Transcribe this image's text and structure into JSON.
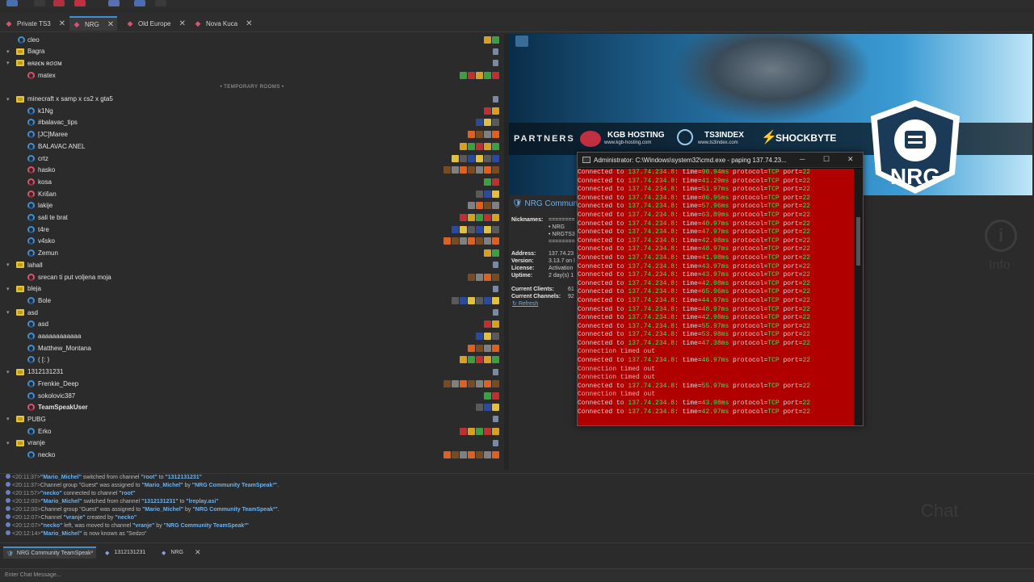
{
  "tabs": [
    {
      "label": "Private TS3",
      "close": "✕"
    },
    {
      "label": "NRG",
      "close": "✕"
    },
    {
      "label": "Old Europe",
      "close": "✕"
    },
    {
      "label": "Nova Kuca",
      "close": "✕"
    }
  ],
  "tree": {
    "rows": [
      {
        "kind": "user",
        "name": "cleo",
        "indent": 0
      },
      {
        "kind": "channel",
        "name": "Bagra"
      },
      {
        "kind": "channel",
        "name": "ѳяƨϵɴ ʀσσм"
      },
      {
        "kind": "user",
        "name": "matex",
        "red": true
      },
      {
        "kind": "spacer",
        "name": "• TEMPORARY ROOMS •"
      },
      {
        "kind": "channel",
        "name": "minecraft x samp x cs2 x gta5"
      },
      {
        "kind": "user",
        "name": "k1Ng"
      },
      {
        "kind": "user",
        "name": "#balavac_tips"
      },
      {
        "kind": "user",
        "name": "[JC]Maree"
      },
      {
        "kind": "user",
        "name": "BALAVAC ANEL"
      },
      {
        "kind": "user",
        "name": "crtz"
      },
      {
        "kind": "user",
        "name": "hasko",
        "red": true
      },
      {
        "kind": "user",
        "name": "kosa",
        "red": true
      },
      {
        "kind": "user",
        "name": "Krišan",
        "red": true
      },
      {
        "kind": "user",
        "name": "lakije"
      },
      {
        "kind": "user",
        "name": "sali te brat"
      },
      {
        "kind": "user",
        "name": "t4re"
      },
      {
        "kind": "user",
        "name": "v4sko"
      },
      {
        "kind": "user",
        "name": "Zemun"
      },
      {
        "kind": "channel",
        "name": "lahall"
      },
      {
        "kind": "user",
        "name": "srecan ti put voljena moja",
        "red": true
      },
      {
        "kind": "channel",
        "name": "bleja"
      },
      {
        "kind": "user",
        "name": "Bole"
      },
      {
        "kind": "channel",
        "name": "asd"
      },
      {
        "kind": "user",
        "name": "asd"
      },
      {
        "kind": "user",
        "name": "aaaaaaaaaaaa"
      },
      {
        "kind": "user",
        "name": "Matthew_Montana"
      },
      {
        "kind": "user",
        "name": "( [: )"
      },
      {
        "kind": "channel",
        "name": "1312131231"
      },
      {
        "kind": "user",
        "name": "Frenkie_Deep"
      },
      {
        "kind": "user",
        "name": "sokolovic387"
      },
      {
        "kind": "user",
        "name": "TeamSpeakUser",
        "bold": true,
        "red": true
      },
      {
        "kind": "channel",
        "name": "PUBG"
      },
      {
        "kind": "user",
        "name": "Erko"
      },
      {
        "kind": "channel",
        "name": "vranje"
      },
      {
        "kind": "user",
        "name": "necko"
      }
    ]
  },
  "banner": {
    "partners": "PARTNERS",
    "p1": "KGB HOSTING",
    "p1s": "www.kgb-hosting.com",
    "p2": "TS3INDEX",
    "p2s": "www.ts3index.com",
    "p3": "SHOCKBYTE",
    "logo": "NRG"
  },
  "server": {
    "title": "NRG Commun",
    "nicknames_label": "Nicknames:",
    "nick1": "========",
    "nick2": "• NRG",
    "nick3": "• NRGTS3",
    "nick4": "========",
    "address_label": "Address:",
    "address": "137.74.23",
    "version_label": "Version:",
    "version": "3.13.7 on l",
    "license_label": "License:",
    "license": "Activation",
    "uptime_label": "Uptime:",
    "uptime": "2 day(s) 1",
    "clients_label": "Current Clients:",
    "clients": "61",
    "channels_label": "Current Channels:",
    "channels": "92",
    "refresh": "Refresh",
    "info": "Info"
  },
  "cmd": {
    "title": "Administrator: C:\\Windows\\system32\\cmd.exe - paping  137.74.23...",
    "lines": [
      {
        "t": "ok",
        "ms": "90.94ms"
      },
      {
        "t": "ok",
        "ms": "41.29ms"
      },
      {
        "t": "ok",
        "ms": "51.97ms"
      },
      {
        "t": "ok",
        "ms": "86.95ms"
      },
      {
        "t": "ok",
        "ms": "57.96ms"
      },
      {
        "t": "ok",
        "ms": "63.89ms"
      },
      {
        "t": "ok",
        "ms": "40.97ms"
      },
      {
        "t": "ok",
        "ms": "47.97ms"
      },
      {
        "t": "ok",
        "ms": "42.98ms"
      },
      {
        "t": "ok",
        "ms": "48.97ms"
      },
      {
        "t": "ok",
        "ms": "41.98ms"
      },
      {
        "t": "ok",
        "ms": "43.97ms"
      },
      {
        "t": "ok",
        "ms": "43.97ms"
      },
      {
        "t": "ok",
        "ms": "42.98ms"
      },
      {
        "t": "ok",
        "ms": "65.96ms"
      },
      {
        "t": "ok",
        "ms": "44.97ms"
      },
      {
        "t": "ok",
        "ms": "48.97ms"
      },
      {
        "t": "ok",
        "ms": "42.98ms"
      },
      {
        "t": "ok",
        "ms": "55.97ms"
      },
      {
        "t": "ok",
        "ms": "53.98ms"
      },
      {
        "t": "ok",
        "ms": "47.38ms"
      },
      {
        "t": "timeout",
        "ms": ""
      },
      {
        "t": "ok",
        "ms": "46.97ms"
      },
      {
        "t": "timeout",
        "ms": ""
      },
      {
        "t": "timeout",
        "ms": ""
      },
      {
        "t": "ok",
        "ms": "55.97ms"
      },
      {
        "t": "timeout",
        "ms": ""
      },
      {
        "t": "ok",
        "ms": "43.98ms"
      },
      {
        "t": "ok",
        "ms": "42.97ms"
      }
    ],
    "connected": "Connected to",
    "ip": "137.74.234.8",
    "timeout_text": "Connection timed out",
    "proto": "TCP",
    "port": "22"
  },
  "log": [
    {
      "ts": "<20:11:37>",
      "a": "\"Mario_Michel\"",
      "mid": " switched from channel ",
      "b": "\"root\"",
      "mid2": " to ",
      "c": "\"1312131231\"",
      "end": ""
    },
    {
      "ts": "<20:11:37>",
      "a": "",
      "mid": "Channel group \"Guest\" was assigned to ",
      "b": "\"Mario_Michel\"",
      "mid2": " by ",
      "c": "\"NRG Community TeamSpeak³\"",
      "end": "."
    },
    {
      "ts": "<20:11:57>",
      "a": "\"necko\"",
      "mid": " connected to channel ",
      "b": "\"root\"",
      "mid2": "",
      "c": "",
      "end": ""
    },
    {
      "ts": "<20:12:00>",
      "a": "\"Mario_Michel\"",
      "mid": " switched from channel ",
      "b": "\"1312131231\"",
      "mid2": " to ",
      "c": "\"lreplay.asi\"",
      "end": ""
    },
    {
      "ts": "<20:12:00>",
      "a": "",
      "mid": "Channel group \"Guest\" was assigned to ",
      "b": "\"Mario_Michel\"",
      "mid2": " by ",
      "c": "\"NRG Community TeamSpeak³\"",
      "end": "."
    },
    {
      "ts": "<20:12:07>",
      "a": "",
      "mid": "Channel ",
      "b": "\"vranje\"",
      "mid2": " created by ",
      "c": "\"necko\"",
      "end": ""
    },
    {
      "ts": "<20:12:07>",
      "a": "\"necko\"",
      "mid": " left, was moved to channel ",
      "b": "\"vranje\"",
      "mid2": " by ",
      "c": "\"NRG Community TeamSpeak³\"",
      "end": ""
    },
    {
      "ts": "<20:12:14>",
      "a": "\"Mario_Michel\"",
      "mid": " is now known as \"Sedzo\"",
      "b": "",
      "mid2": "",
      "c": "",
      "end": ""
    }
  ],
  "chat": {
    "bg": "Chat",
    "tabs": [
      "NRG Community TeamSpeak³",
      "1312131231",
      "NRG"
    ],
    "close": "✕",
    "placeholder": "Enter Chat Message..."
  }
}
